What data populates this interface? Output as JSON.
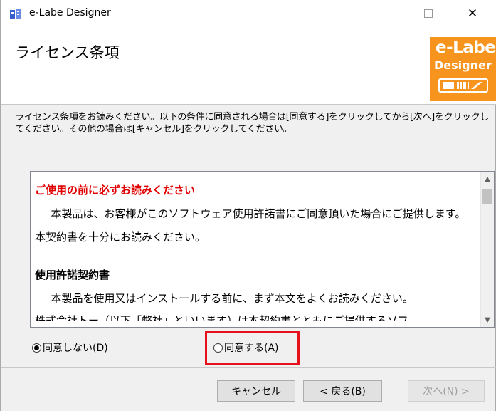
{
  "window": {
    "title": "e-Labe Designer",
    "close_glyph": "✕"
  },
  "header": {
    "page_title": "ライセンス条項",
    "logo": {
      "line1": "e-Labe",
      "line2": "Designer"
    }
  },
  "description": "ライセンス条項をお読みください。以下の条件に同意される場合は[同意する]をクリックしてから[次へ]をクリックしてください。その他の場合は[キャンセル]をクリックしてください。",
  "license": {
    "heading": "ご使用の前に必ずお読みください",
    "para1": "本製品は、お客様がこのソフトウェア使用許諾書にご同意頂いた場合にご提供します。本契約書を十分にお読みください。",
    "section_title": "使用許諾契約書",
    "para2": "本製品を使用又はインストールする前に、まず本文をよくお読みください。",
    "partial_line": "株式会社トー（以下「弊社」といいます）は本契約書とともにご提供するソフ"
  },
  "options": {
    "decline_label": "同意しない(D)",
    "accept_label": "同意する(A)",
    "selected": "decline"
  },
  "buttons": {
    "cancel": "キャンセル",
    "back": "< 戻る(B)",
    "next": "次へ(N) >"
  },
  "colors": {
    "accent_orange": "#f7941d",
    "highlight_red": "#e8111b",
    "heading_red": "#e00000"
  }
}
